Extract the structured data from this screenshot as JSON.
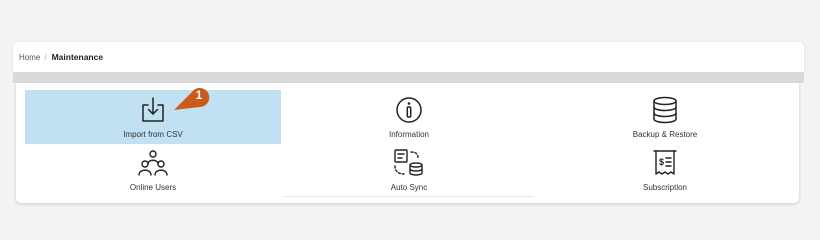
{
  "breadcrumb": {
    "home": "Home",
    "separator": "/",
    "current": "Maintenance"
  },
  "tiles": [
    {
      "label": "Import from CSV",
      "icon": "import-icon",
      "selected": true
    },
    {
      "label": "Information",
      "icon": "info-icon",
      "selected": false
    },
    {
      "label": "Backup & Restore",
      "icon": "database-icon",
      "selected": false
    },
    {
      "label": "Online Users",
      "icon": "users-icon",
      "selected": false
    },
    {
      "label": "Auto Sync",
      "icon": "sync-icon",
      "selected": false
    },
    {
      "label": "Subscription",
      "icon": "receipt-icon",
      "selected": false
    }
  ],
  "annotation": {
    "step": "1",
    "color": "#cc5a1c"
  },
  "colors": {
    "selected_bg": "#c1e1f2",
    "icon_stroke": "#222222"
  }
}
